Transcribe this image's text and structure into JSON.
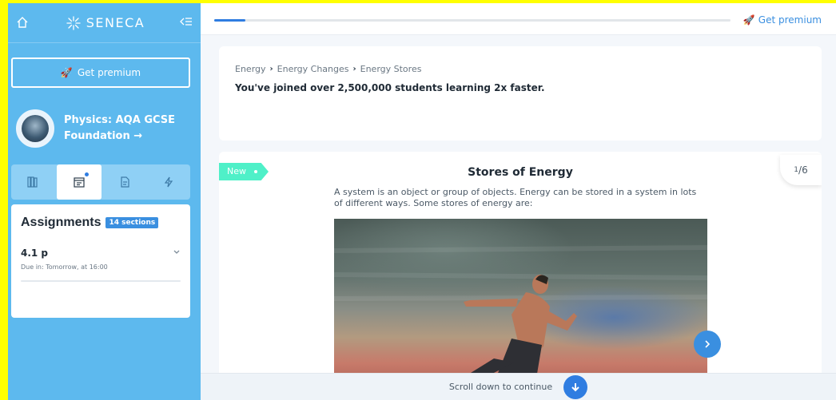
{
  "sidebar": {
    "brand": "SENECA",
    "premium_label": "Get premium",
    "course_title": "Physics: AQA GCSE Foundation →",
    "tabs": [
      {
        "name": "library",
        "icon": "books-icon"
      },
      {
        "name": "assignments",
        "icon": "calendar-icon"
      },
      {
        "name": "notes",
        "icon": "document-icon"
      },
      {
        "name": "quick",
        "icon": "lightning-icon"
      }
    ],
    "assignments": {
      "title": "Assignments",
      "badge": "14 sections",
      "items": [
        {
          "title": "4.1 p",
          "due": "Due in: Tomorrow, at 16:00"
        }
      ]
    }
  },
  "topbar": {
    "premium_label": "Get premium",
    "progress": 0.06
  },
  "info": {
    "breadcrumb": [
      "Energy",
      "Energy Changes",
      "Energy Stores"
    ],
    "joined": "You've joined over 2,500,000 students learning 2x faster."
  },
  "card": {
    "tag": "New",
    "counter_current": "1",
    "counter_total": "6",
    "title": "Stores of Energy",
    "body": "A system is an object or group of objects. Energy can be stored in a system in lots of different ways. Some stores of energy are:"
  },
  "bottom": {
    "scroll_label": "Scroll down to continue"
  },
  "colors": {
    "sidebar": "#5db9ee",
    "accent": "#2f7de1",
    "new_tag": "#4ff0c8",
    "frame": "#ffff00"
  }
}
